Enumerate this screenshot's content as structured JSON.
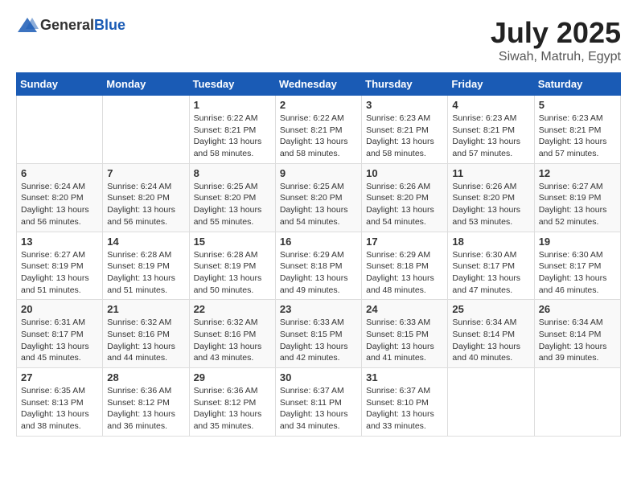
{
  "header": {
    "logo_general": "General",
    "logo_blue": "Blue",
    "month_year": "July 2025",
    "location": "Siwah, Matruh, Egypt"
  },
  "weekdays": [
    "Sunday",
    "Monday",
    "Tuesday",
    "Wednesday",
    "Thursday",
    "Friday",
    "Saturday"
  ],
  "weeks": [
    [
      {
        "day": "",
        "sunrise": "",
        "sunset": "",
        "daylight": ""
      },
      {
        "day": "",
        "sunrise": "",
        "sunset": "",
        "daylight": ""
      },
      {
        "day": "1",
        "sunrise": "Sunrise: 6:22 AM",
        "sunset": "Sunset: 8:21 PM",
        "daylight": "Daylight: 13 hours and 58 minutes."
      },
      {
        "day": "2",
        "sunrise": "Sunrise: 6:22 AM",
        "sunset": "Sunset: 8:21 PM",
        "daylight": "Daylight: 13 hours and 58 minutes."
      },
      {
        "day": "3",
        "sunrise": "Sunrise: 6:23 AM",
        "sunset": "Sunset: 8:21 PM",
        "daylight": "Daylight: 13 hours and 58 minutes."
      },
      {
        "day": "4",
        "sunrise": "Sunrise: 6:23 AM",
        "sunset": "Sunset: 8:21 PM",
        "daylight": "Daylight: 13 hours and 57 minutes."
      },
      {
        "day": "5",
        "sunrise": "Sunrise: 6:23 AM",
        "sunset": "Sunset: 8:21 PM",
        "daylight": "Daylight: 13 hours and 57 minutes."
      }
    ],
    [
      {
        "day": "6",
        "sunrise": "Sunrise: 6:24 AM",
        "sunset": "Sunset: 8:20 PM",
        "daylight": "Daylight: 13 hours and 56 minutes."
      },
      {
        "day": "7",
        "sunrise": "Sunrise: 6:24 AM",
        "sunset": "Sunset: 8:20 PM",
        "daylight": "Daylight: 13 hours and 56 minutes."
      },
      {
        "day": "8",
        "sunrise": "Sunrise: 6:25 AM",
        "sunset": "Sunset: 8:20 PM",
        "daylight": "Daylight: 13 hours and 55 minutes."
      },
      {
        "day": "9",
        "sunrise": "Sunrise: 6:25 AM",
        "sunset": "Sunset: 8:20 PM",
        "daylight": "Daylight: 13 hours and 54 minutes."
      },
      {
        "day": "10",
        "sunrise": "Sunrise: 6:26 AM",
        "sunset": "Sunset: 8:20 PM",
        "daylight": "Daylight: 13 hours and 54 minutes."
      },
      {
        "day": "11",
        "sunrise": "Sunrise: 6:26 AM",
        "sunset": "Sunset: 8:20 PM",
        "daylight": "Daylight: 13 hours and 53 minutes."
      },
      {
        "day": "12",
        "sunrise": "Sunrise: 6:27 AM",
        "sunset": "Sunset: 8:19 PM",
        "daylight": "Daylight: 13 hours and 52 minutes."
      }
    ],
    [
      {
        "day": "13",
        "sunrise": "Sunrise: 6:27 AM",
        "sunset": "Sunset: 8:19 PM",
        "daylight": "Daylight: 13 hours and 51 minutes."
      },
      {
        "day": "14",
        "sunrise": "Sunrise: 6:28 AM",
        "sunset": "Sunset: 8:19 PM",
        "daylight": "Daylight: 13 hours and 51 minutes."
      },
      {
        "day": "15",
        "sunrise": "Sunrise: 6:28 AM",
        "sunset": "Sunset: 8:19 PM",
        "daylight": "Daylight: 13 hours and 50 minutes."
      },
      {
        "day": "16",
        "sunrise": "Sunrise: 6:29 AM",
        "sunset": "Sunset: 8:18 PM",
        "daylight": "Daylight: 13 hours and 49 minutes."
      },
      {
        "day": "17",
        "sunrise": "Sunrise: 6:29 AM",
        "sunset": "Sunset: 8:18 PM",
        "daylight": "Daylight: 13 hours and 48 minutes."
      },
      {
        "day": "18",
        "sunrise": "Sunrise: 6:30 AM",
        "sunset": "Sunset: 8:17 PM",
        "daylight": "Daylight: 13 hours and 47 minutes."
      },
      {
        "day": "19",
        "sunrise": "Sunrise: 6:30 AM",
        "sunset": "Sunset: 8:17 PM",
        "daylight": "Daylight: 13 hours and 46 minutes."
      }
    ],
    [
      {
        "day": "20",
        "sunrise": "Sunrise: 6:31 AM",
        "sunset": "Sunset: 8:17 PM",
        "daylight": "Daylight: 13 hours and 45 minutes."
      },
      {
        "day": "21",
        "sunrise": "Sunrise: 6:32 AM",
        "sunset": "Sunset: 8:16 PM",
        "daylight": "Daylight: 13 hours and 44 minutes."
      },
      {
        "day": "22",
        "sunrise": "Sunrise: 6:32 AM",
        "sunset": "Sunset: 8:16 PM",
        "daylight": "Daylight: 13 hours and 43 minutes."
      },
      {
        "day": "23",
        "sunrise": "Sunrise: 6:33 AM",
        "sunset": "Sunset: 8:15 PM",
        "daylight": "Daylight: 13 hours and 42 minutes."
      },
      {
        "day": "24",
        "sunrise": "Sunrise: 6:33 AM",
        "sunset": "Sunset: 8:15 PM",
        "daylight": "Daylight: 13 hours and 41 minutes."
      },
      {
        "day": "25",
        "sunrise": "Sunrise: 6:34 AM",
        "sunset": "Sunset: 8:14 PM",
        "daylight": "Daylight: 13 hours and 40 minutes."
      },
      {
        "day": "26",
        "sunrise": "Sunrise: 6:34 AM",
        "sunset": "Sunset: 8:14 PM",
        "daylight": "Daylight: 13 hours and 39 minutes."
      }
    ],
    [
      {
        "day": "27",
        "sunrise": "Sunrise: 6:35 AM",
        "sunset": "Sunset: 8:13 PM",
        "daylight": "Daylight: 13 hours and 38 minutes."
      },
      {
        "day": "28",
        "sunrise": "Sunrise: 6:36 AM",
        "sunset": "Sunset: 8:12 PM",
        "daylight": "Daylight: 13 hours and 36 minutes."
      },
      {
        "day": "29",
        "sunrise": "Sunrise: 6:36 AM",
        "sunset": "Sunset: 8:12 PM",
        "daylight": "Daylight: 13 hours and 35 minutes."
      },
      {
        "day": "30",
        "sunrise": "Sunrise: 6:37 AM",
        "sunset": "Sunset: 8:11 PM",
        "daylight": "Daylight: 13 hours and 34 minutes."
      },
      {
        "day": "31",
        "sunrise": "Sunrise: 6:37 AM",
        "sunset": "Sunset: 8:10 PM",
        "daylight": "Daylight: 13 hours and 33 minutes."
      },
      {
        "day": "",
        "sunrise": "",
        "sunset": "",
        "daylight": ""
      },
      {
        "day": "",
        "sunrise": "",
        "sunset": "",
        "daylight": ""
      }
    ]
  ]
}
